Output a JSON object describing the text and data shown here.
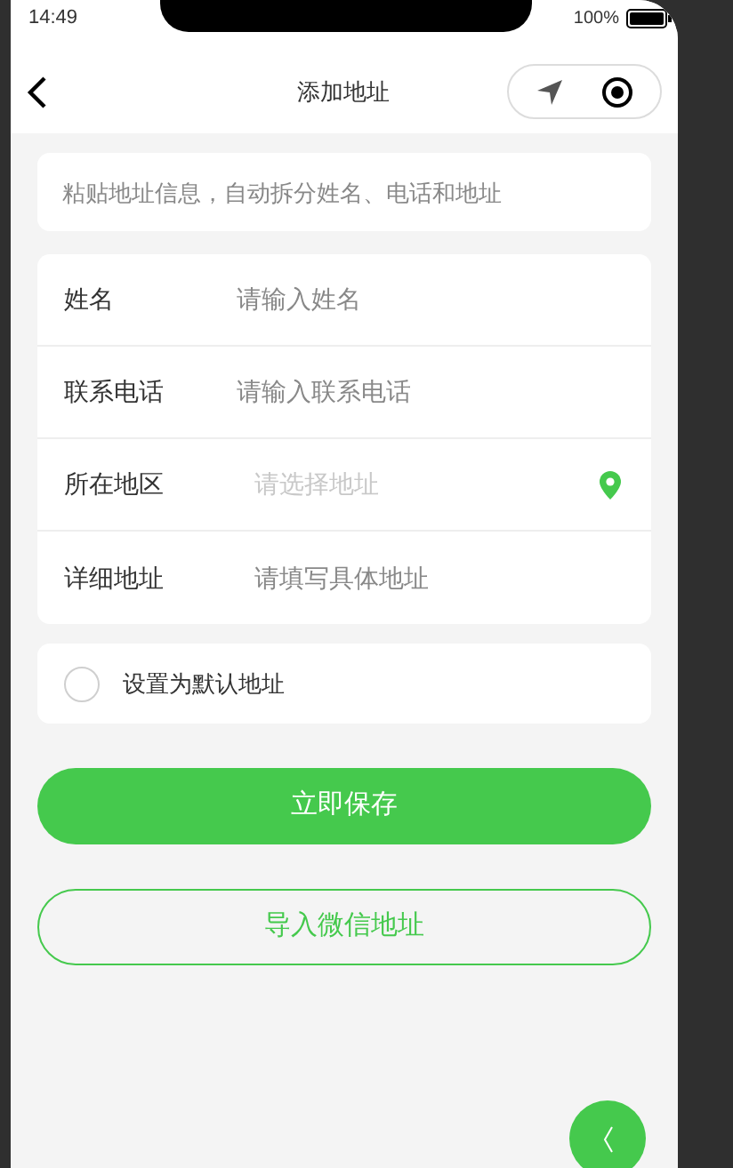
{
  "status_bar": {
    "time": "14:49",
    "battery": "100%"
  },
  "nav": {
    "title": "添加地址"
  },
  "paste_box": {
    "placeholder": "粘贴地址信息，自动拆分姓名、电话和地址"
  },
  "fields": [
    {
      "kind": "input",
      "label": "姓名",
      "placeholder": "请输入姓名"
    },
    {
      "kind": "input",
      "label": "联系电话",
      "placeholder": "请输入联系电话"
    },
    {
      "kind": "picker",
      "label": "所在地区",
      "placeholder": "请选择地址"
    },
    {
      "kind": "detail",
      "label": "详细地址",
      "placeholder": "请填写具体地址"
    }
  ],
  "default_option": {
    "label": "设置为默认地址",
    "checked": false
  },
  "buttons": [
    {
      "kind": "primary",
      "label": "立即保存"
    },
    {
      "kind": "outline",
      "label": "导入微信地址"
    }
  ]
}
